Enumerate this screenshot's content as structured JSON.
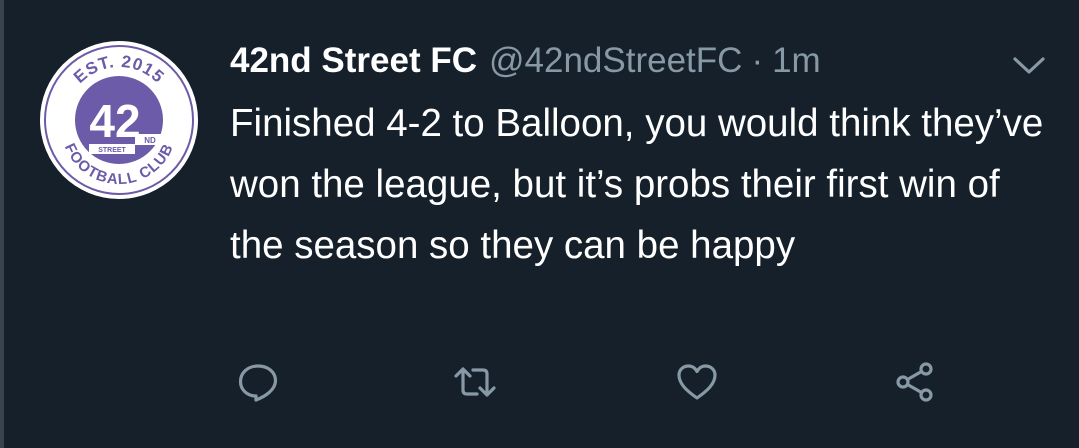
{
  "tweet": {
    "display_name": "42nd Street FC",
    "handle": "@42ndStreetFC",
    "separator": "·",
    "timestamp": "1m",
    "text": "Finished 4-2 to Balloon, you would think they’ve won the league, but it’s probs their first win of the season so they can be happy"
  },
  "avatar": {
    "top_text": "EST. 2015",
    "number": "42",
    "suffix": "ND",
    "banner": "STREET",
    "bottom_text": "FOOTBALL CLUB",
    "ring_color": "#6b5ba8",
    "fill_color": "#ffffff"
  },
  "actions": {
    "icons": [
      "reply-icon",
      "retweet-icon",
      "like-icon",
      "share-icon"
    ],
    "icon_color": "#8899a6"
  },
  "theme": {
    "background": "#15202b",
    "text_primary": "#ffffff",
    "text_secondary": "#8899a6"
  }
}
